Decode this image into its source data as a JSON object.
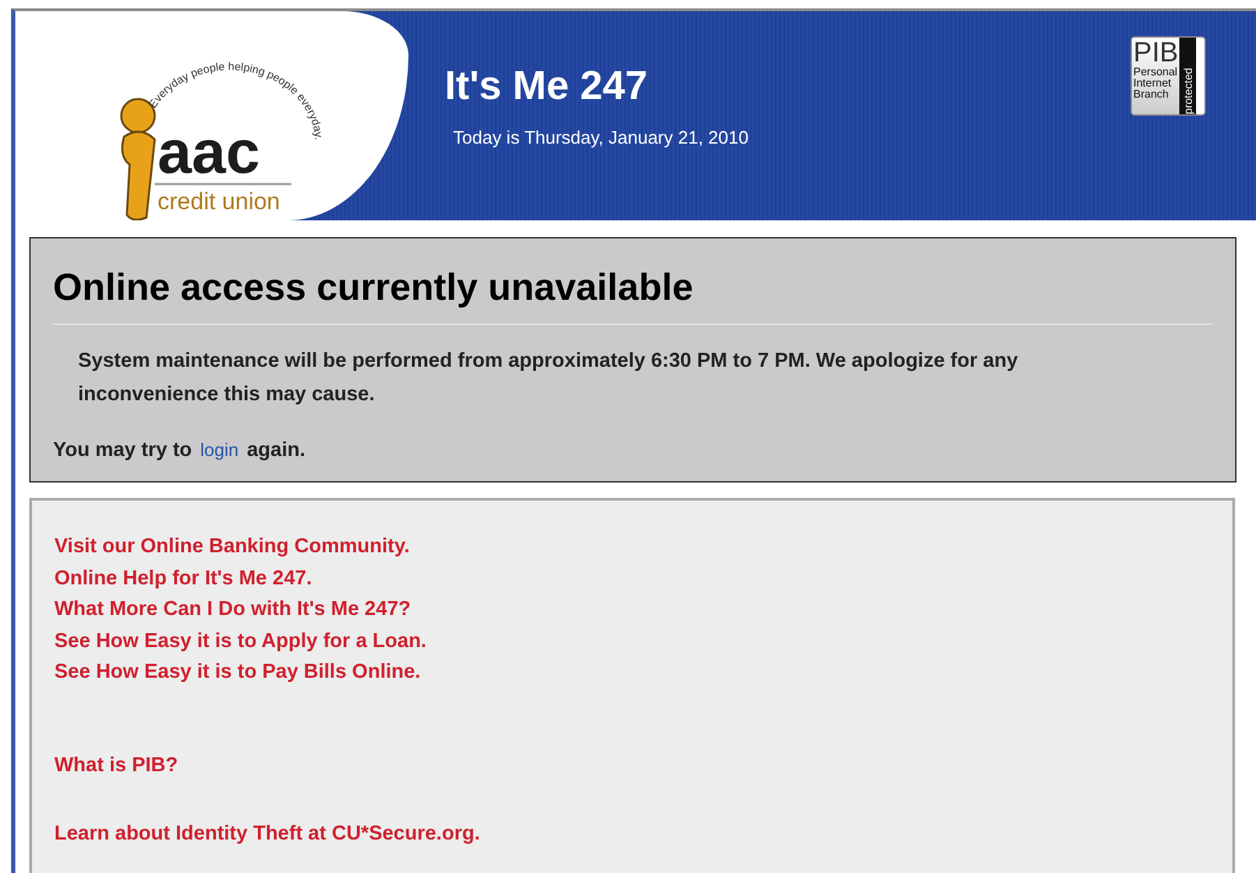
{
  "logo": {
    "name": "aac",
    "subtitle": "credit union",
    "tagline": "Everyday people helping people everyday."
  },
  "header": {
    "title": "It's Me 247",
    "date": "Today is Thursday, January 21, 2010"
  },
  "badge": {
    "initials": "PIB",
    "words": [
      "Personal",
      "Internet",
      "Branch"
    ],
    "side": "protected"
  },
  "notice": {
    "heading": "Online access currently unavailable",
    "message": "System maintenance will be performed from approximately 6:30 PM to 7 PM. We apologize for any inconvenience this may cause.",
    "retry_before": "You may try to",
    "retry_link": "login",
    "retry_after": "again."
  },
  "link_groups": [
    [
      "Visit our Online Banking Community.",
      "Online Help for It's Me 247.",
      "What More Can I Do with It's Me 247?",
      "See How Easy it is to Apply for a Loan.",
      "See How Easy it is to Pay Bills Online."
    ],
    [
      "What is PIB?"
    ],
    [
      "Learn about Identity Theft at CU*Secure.org."
    ]
  ]
}
